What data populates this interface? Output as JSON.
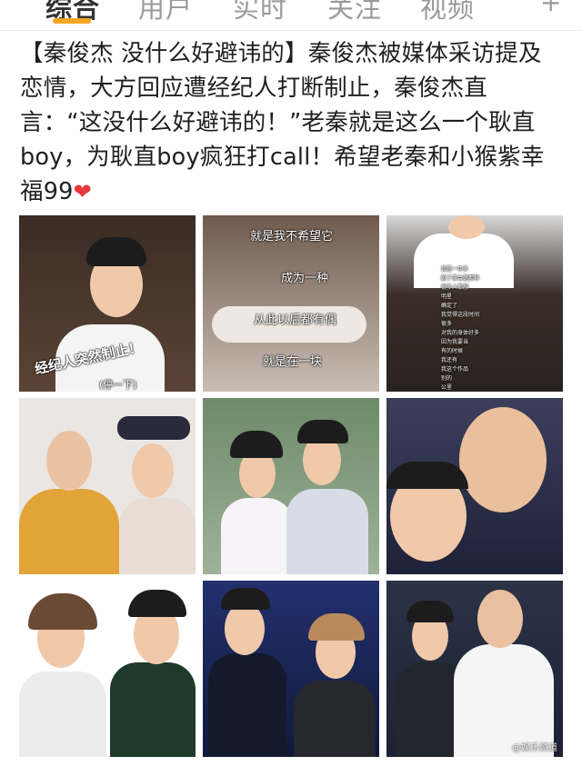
{
  "tabs": [
    {
      "label": "综合",
      "active": true
    },
    {
      "label": "用户",
      "active": false
    },
    {
      "label": "实时",
      "active": false
    },
    {
      "label": "关注",
      "active": false
    },
    {
      "label": "视频",
      "active": false
    }
  ],
  "more_icon": "plus-icon",
  "accent_color": "#f5a623",
  "post": {
    "lines": [
      "【秦俊杰 没什么好避讳的】秦俊杰被媒体采访提及",
      "恋情，大方回应遭经纪人打断制止，秦俊杰直",
      "言：“这没什么好避讳的！”老秦就是这么一个耿直",
      "boy，为耿直boy疯狂打call！希望老秦和小猴紫幸",
      "福99"
    ],
    "heart_icon": "red-heart-icon"
  },
  "images": [
    {
      "caption": "经纪人突然制止！",
      "subcaption": "(停一下)"
    },
    {
      "lines": [
        "就是我不希望它",
        "成为一种",
        "从此以后都有偶",
        "就是在一块"
      ]
    },
    {
      "lines": [
        "我是一年多",
        "剧了拿会是那种",
        "很多人都想",
        "明星",
        "确定了",
        "我觉得这段时间",
        "很多",
        "对我的身体好多",
        "因为我要当",
        "有的时候",
        "我还有",
        "我这个作品",
        "别的",
        "公里"
      ]
    },
    {},
    {},
    {},
    {},
    {},
    {
      "watermark": "@娱乐频道"
    }
  ]
}
